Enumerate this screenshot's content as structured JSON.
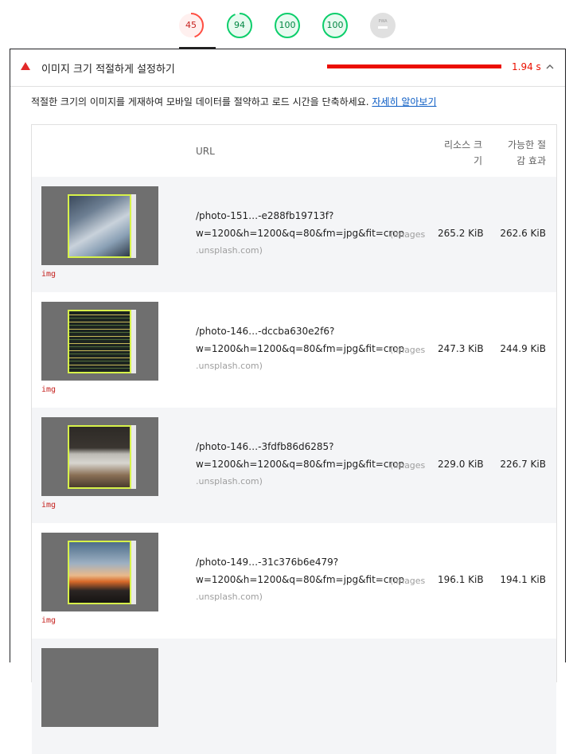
{
  "scores": [
    {
      "value": "45",
      "color": "#ff4e42",
      "fill": 0.45
    },
    {
      "value": "94",
      "color": "#0cce6b",
      "fill": 0.94
    },
    {
      "value": "100",
      "color": "#0cce6b",
      "fill": 1.0
    },
    {
      "value": "100",
      "color": "#0cce6b",
      "fill": 1.0
    },
    {
      "value": "PWA",
      "color": "#cccccc",
      "fill": 1.0
    }
  ],
  "audit": {
    "title": "이미지 크기 적절하게 설정하기",
    "savings": "1.94 s",
    "description": "적절한 크기의 이미지를 게재하여 모바일 데이터를 절약하고 로드 시간을 단축하세요.",
    "learn_more": "자세히 알아보기"
  },
  "table": {
    "headers": {
      "url": "URL",
      "resource_size_1": "리소스 크",
      "resource_size_2": "기",
      "savings_1": "가능한 절",
      "savings_2": "감 효과"
    },
    "rows": [
      {
        "tag": "img",
        "path": "/photo-151…-e288fb19713f?",
        "query": "w=1200&h=1200&q=80&fm=jpg&fit=crop",
        "host_a": "(images",
        "host_b": ".unsplash.com)",
        "size": "265.2 KiB",
        "savings": "262.6 KiB",
        "photo": "laptop-team"
      },
      {
        "tag": "img",
        "path": "/photo-146…-dccba630e2f6?",
        "query": "w=1200&h=1200&q=80&fm=jpg&fit=crop",
        "host_a": "(images",
        "host_b": ".unsplash.com)",
        "size": "247.3 KiB",
        "savings": "244.9 KiB",
        "photo": "code-screen"
      },
      {
        "tag": "img",
        "path": "/photo-146…-3fdfb86d6285?",
        "query": "w=1200&h=1200&q=80&fm=jpg&fit=crop",
        "host_a": "(images",
        "host_b": ".unsplash.com)",
        "size": "229.0 KiB",
        "savings": "226.7 KiB",
        "photo": "typing-laptop"
      },
      {
        "tag": "img",
        "path": "/photo-149…-31c376b6e479?",
        "query": "w=1200&h=1200&q=80&fm=jpg&fit=crop",
        "host_a": "(images",
        "host_b": ".unsplash.com)",
        "size": "196.1 KiB",
        "savings": "194.1 KiB",
        "photo": "sunset-window"
      }
    ]
  }
}
